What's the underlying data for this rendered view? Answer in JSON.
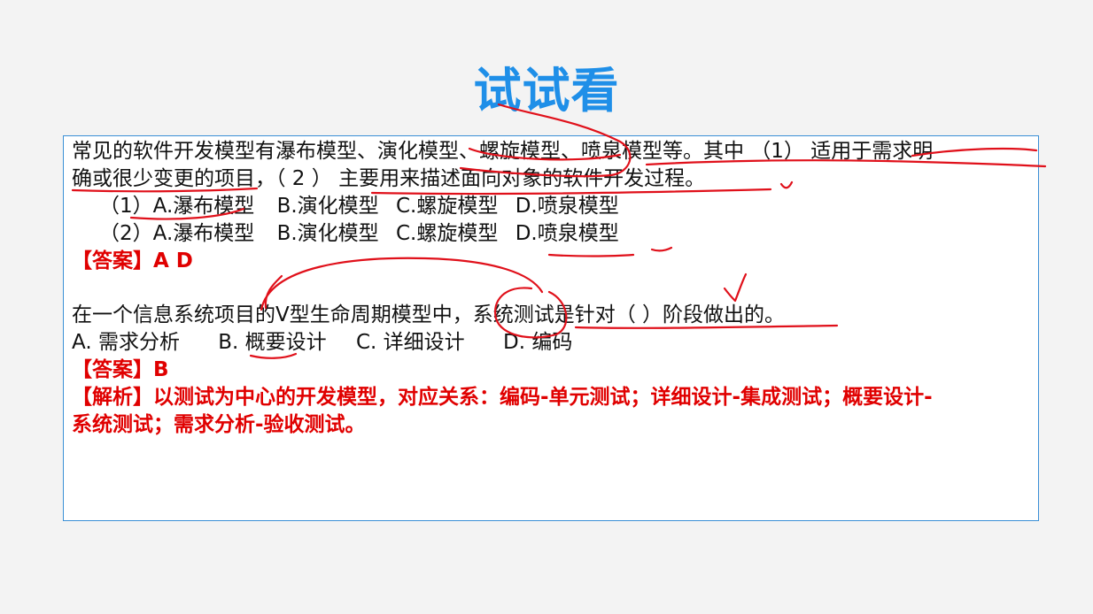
{
  "title": "试试看",
  "q1": {
    "stem_line1": "常见的软件开发模型有瀑布模型、演化模型、螺旋模型、喷泉模型等。其中 （1） 适用于需求明",
    "stem_line2": "确或很少变更的项目，（ 2 ） 主要用来描述面向对象的软件开发过程。",
    "opt1_label": "（1）",
    "opt1_a": "A.瀑布模型",
    "opt1_b": "B.演化模型",
    "opt1_c": "C.螺旋模型",
    "opt1_d": "D.喷泉模型",
    "opt2_label": "（2）",
    "opt2_a": "A.瀑布模型",
    "opt2_b": "B.演化模型",
    "opt2_c": "C.螺旋模型",
    "opt2_d": "D.喷泉模型",
    "answer": "【答案】A D"
  },
  "q2": {
    "stem": "在一个信息系统项目的V型生命周期模型中，系统测试是针对（ ）阶段做出的。",
    "opt_a": "A. 需求分析",
    "opt_b": "B. 概要设计",
    "opt_c": "C. 详细设计",
    "opt_d": "D. 编码",
    "answer": "【答案】B",
    "analysis_line1": "【解析】以测试为中心的开发模型，对应关系：编码-单元测试；详细设计-集成测试；概要设计-",
    "analysis_line2": "系统测试；需求分析-验收测试。"
  },
  "colors": {
    "title": "#1f8fe8",
    "border": "#3a8fd6",
    "answer": "#e00000",
    "annotation": "#e0101a"
  }
}
